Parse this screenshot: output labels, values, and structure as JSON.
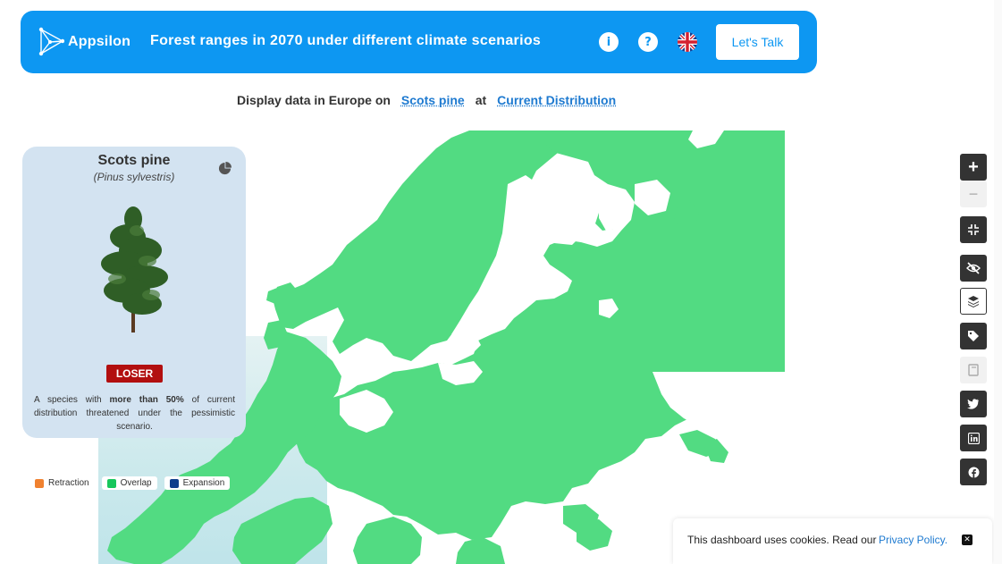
{
  "header": {
    "logo_text": "Appsilon",
    "title": "Forest ranges in 2070 under different climate scenarios",
    "info_icon_glyph": "i",
    "help_icon_glyph": "?",
    "cta_label": "Let's Talk",
    "background_color": "#0d97f2"
  },
  "selector": {
    "prefix": "Display data in Europe on",
    "species_value": "Scots pine",
    "connector": "at",
    "scenario_value": "Current Distribution"
  },
  "species_card": {
    "name": "Scots pine",
    "latin_name": "(Pinus sylvestris)",
    "status_badge": "LOSER",
    "description_prefix": "A species with",
    "description_bold": "more than 50%",
    "description_suffix": "of current distribution threatened under the pessimistic scenario.",
    "icon": "pie-chart-icon"
  },
  "legend": {
    "items": [
      {
        "label": "Retraction",
        "color": "#f0812f"
      },
      {
        "label": "Overlap",
        "color": "#16c75c"
      },
      {
        "label": "Expansion",
        "color": "#0d3d8c"
      }
    ]
  },
  "map": {
    "land_color": "#52db82"
  },
  "controls": {
    "zoom_in_glyph": "+",
    "zoom_out_glyph": "−"
  },
  "cookie": {
    "text": "This dashboard uses cookies. Read our",
    "link_label": "Privacy Policy.",
    "close_glyph": "✕"
  }
}
